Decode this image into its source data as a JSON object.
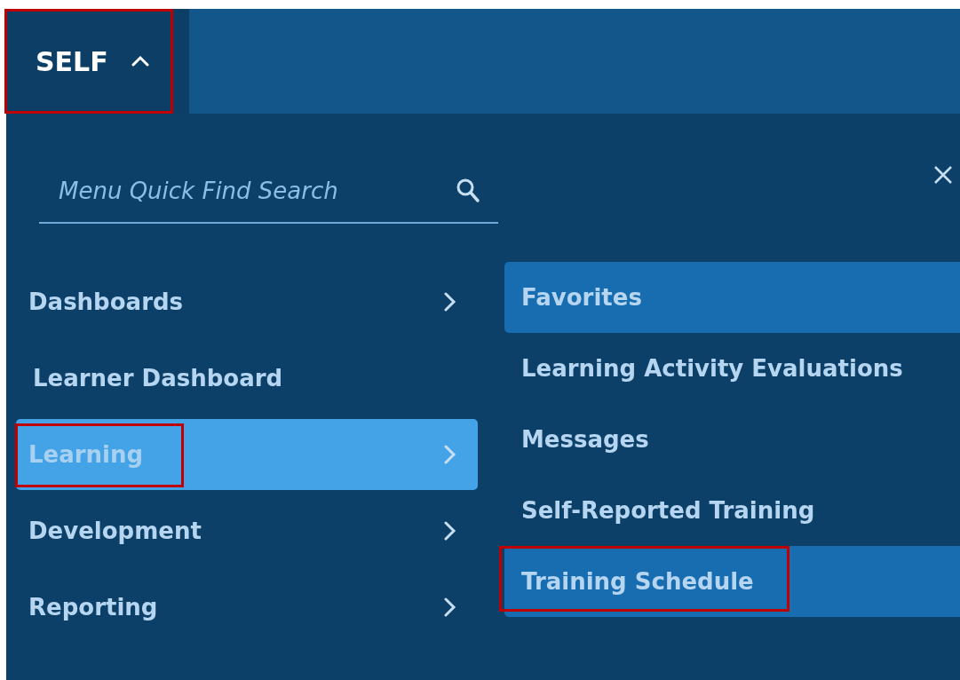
{
  "top_tab": {
    "label": "SELF",
    "expanded": true,
    "highlighted": true
  },
  "search": {
    "placeholder": "Menu Quick Find Search"
  },
  "menu": [
    {
      "label": "Dashboards",
      "kind": "group",
      "selected": false,
      "highlighted": false
    },
    {
      "label": "Learner Dashboard",
      "kind": "link",
      "selected": false,
      "highlighted": false
    },
    {
      "label": "Learning",
      "kind": "group",
      "selected": true,
      "highlighted": true
    },
    {
      "label": "Development",
      "kind": "group",
      "selected": false,
      "highlighted": false
    },
    {
      "label": "Reporting",
      "kind": "group",
      "selected": false,
      "highlighted": false
    }
  ],
  "submenu": [
    {
      "label": "Favorites",
      "active": true,
      "highlighted": false
    },
    {
      "label": "Learning Activity Evaluations",
      "active": false,
      "highlighted": false
    },
    {
      "label": "Messages",
      "active": false,
      "highlighted": false
    },
    {
      "label": "Self-Reported Training",
      "active": false,
      "highlighted": false
    },
    {
      "label": "Training Schedule",
      "active": true,
      "highlighted": true
    }
  ]
}
